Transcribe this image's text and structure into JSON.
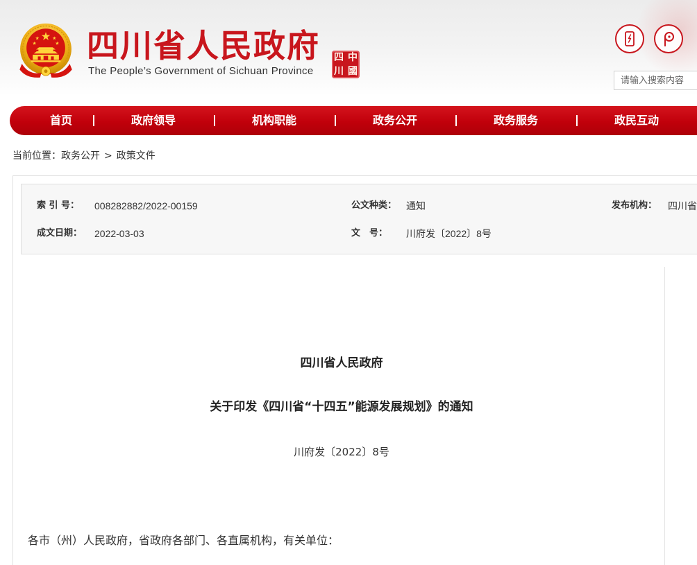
{
  "colors": {
    "brand_red": "#c8161d",
    "nav_red": "#c1000b",
    "nav_text": "#ffffff",
    "text_dark": "#222222",
    "text_body": "#333333",
    "info_bg": "#f7f7f7"
  },
  "header": {
    "emblem_icon": "national-emblem-icon",
    "title": "四川省人民政府",
    "subtitle": "The People’s Government of Sichuan Province",
    "seal": {
      "icon": "sichuan-seal-logo",
      "chars": [
        "中",
        "國",
        "四",
        "川"
      ]
    },
    "tool_icons": [
      "mobile-phone-icon",
      "pin-icon"
    ],
    "search": {
      "placeholder": "请输入搜索内容"
    }
  },
  "nav": {
    "items": [
      {
        "label": "首页"
      },
      {
        "label": "政府领导"
      },
      {
        "label": "机构职能"
      },
      {
        "label": "政务公开"
      },
      {
        "label": "政务服务"
      },
      {
        "label": "政民互动"
      }
    ]
  },
  "breadcrumb": {
    "prefix": "当前位置：",
    "items": [
      "政务公开",
      "政策文件"
    ],
    "separator": ">"
  },
  "doc_info": {
    "index_number": {
      "label": "索 引 号：",
      "value": "008282882/2022-00159"
    },
    "document_type": {
      "label": "公文种类：",
      "value": "通知"
    },
    "publisher": {
      "label": "发布机构：",
      "value": "四川省"
    },
    "written_date": {
      "label": "成文日期：",
      "value": "2022-03-03"
    },
    "document_number": {
      "label": "文　号：",
      "value": "川府发〔2022〕8号"
    }
  },
  "article": {
    "issuer": "四川省人民政府",
    "title": "关于印发《四川省“十四五”能源发展规划》的通知",
    "doc_number": "川府发〔2022〕8号",
    "salutation": "各市（州）人民政府，省政府各部门、各直属机构，有关单位："
  }
}
